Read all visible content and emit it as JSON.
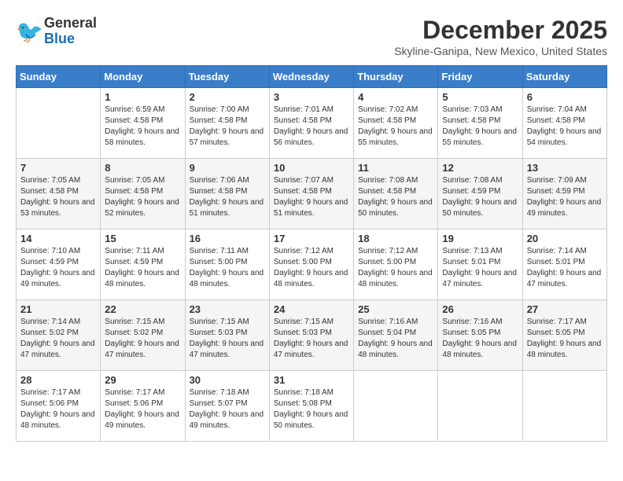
{
  "header": {
    "logo_general": "General",
    "logo_blue": "Blue",
    "month_title": "December 2025",
    "location": "Skyline-Ganipa, New Mexico, United States"
  },
  "days_of_week": [
    "Sunday",
    "Monday",
    "Tuesday",
    "Wednesday",
    "Thursday",
    "Friday",
    "Saturday"
  ],
  "weeks": [
    [
      {
        "day": "",
        "sunrise": "",
        "sunset": "",
        "daylight": ""
      },
      {
        "day": "1",
        "sunrise": "Sunrise: 6:59 AM",
        "sunset": "Sunset: 4:58 PM",
        "daylight": "Daylight: 9 hours and 58 minutes."
      },
      {
        "day": "2",
        "sunrise": "Sunrise: 7:00 AM",
        "sunset": "Sunset: 4:58 PM",
        "daylight": "Daylight: 9 hours and 57 minutes."
      },
      {
        "day": "3",
        "sunrise": "Sunrise: 7:01 AM",
        "sunset": "Sunset: 4:58 PM",
        "daylight": "Daylight: 9 hours and 56 minutes."
      },
      {
        "day": "4",
        "sunrise": "Sunrise: 7:02 AM",
        "sunset": "Sunset: 4:58 PM",
        "daylight": "Daylight: 9 hours and 55 minutes."
      },
      {
        "day": "5",
        "sunrise": "Sunrise: 7:03 AM",
        "sunset": "Sunset: 4:58 PM",
        "daylight": "Daylight: 9 hours and 55 minutes."
      },
      {
        "day": "6",
        "sunrise": "Sunrise: 7:04 AM",
        "sunset": "Sunset: 4:58 PM",
        "daylight": "Daylight: 9 hours and 54 minutes."
      }
    ],
    [
      {
        "day": "7",
        "sunrise": "Sunrise: 7:05 AM",
        "sunset": "Sunset: 4:58 PM",
        "daylight": "Daylight: 9 hours and 53 minutes."
      },
      {
        "day": "8",
        "sunrise": "Sunrise: 7:05 AM",
        "sunset": "Sunset: 4:58 PM",
        "daylight": "Daylight: 9 hours and 52 minutes."
      },
      {
        "day": "9",
        "sunrise": "Sunrise: 7:06 AM",
        "sunset": "Sunset: 4:58 PM",
        "daylight": "Daylight: 9 hours and 51 minutes."
      },
      {
        "day": "10",
        "sunrise": "Sunrise: 7:07 AM",
        "sunset": "Sunset: 4:58 PM",
        "daylight": "Daylight: 9 hours and 51 minutes."
      },
      {
        "day": "11",
        "sunrise": "Sunrise: 7:08 AM",
        "sunset": "Sunset: 4:58 PM",
        "daylight": "Daylight: 9 hours and 50 minutes."
      },
      {
        "day": "12",
        "sunrise": "Sunrise: 7:08 AM",
        "sunset": "Sunset: 4:59 PM",
        "daylight": "Daylight: 9 hours and 50 minutes."
      },
      {
        "day": "13",
        "sunrise": "Sunrise: 7:09 AM",
        "sunset": "Sunset: 4:59 PM",
        "daylight": "Daylight: 9 hours and 49 minutes."
      }
    ],
    [
      {
        "day": "14",
        "sunrise": "Sunrise: 7:10 AM",
        "sunset": "Sunset: 4:59 PM",
        "daylight": "Daylight: 9 hours and 49 minutes."
      },
      {
        "day": "15",
        "sunrise": "Sunrise: 7:11 AM",
        "sunset": "Sunset: 4:59 PM",
        "daylight": "Daylight: 9 hours and 48 minutes."
      },
      {
        "day": "16",
        "sunrise": "Sunrise: 7:11 AM",
        "sunset": "Sunset: 5:00 PM",
        "daylight": "Daylight: 9 hours and 48 minutes."
      },
      {
        "day": "17",
        "sunrise": "Sunrise: 7:12 AM",
        "sunset": "Sunset: 5:00 PM",
        "daylight": "Daylight: 9 hours and 48 minutes."
      },
      {
        "day": "18",
        "sunrise": "Sunrise: 7:12 AM",
        "sunset": "Sunset: 5:00 PM",
        "daylight": "Daylight: 9 hours and 48 minutes."
      },
      {
        "day": "19",
        "sunrise": "Sunrise: 7:13 AM",
        "sunset": "Sunset: 5:01 PM",
        "daylight": "Daylight: 9 hours and 47 minutes."
      },
      {
        "day": "20",
        "sunrise": "Sunrise: 7:14 AM",
        "sunset": "Sunset: 5:01 PM",
        "daylight": "Daylight: 9 hours and 47 minutes."
      }
    ],
    [
      {
        "day": "21",
        "sunrise": "Sunrise: 7:14 AM",
        "sunset": "Sunset: 5:02 PM",
        "daylight": "Daylight: 9 hours and 47 minutes."
      },
      {
        "day": "22",
        "sunrise": "Sunrise: 7:15 AM",
        "sunset": "Sunset: 5:02 PM",
        "daylight": "Daylight: 9 hours and 47 minutes."
      },
      {
        "day": "23",
        "sunrise": "Sunrise: 7:15 AM",
        "sunset": "Sunset: 5:03 PM",
        "daylight": "Daylight: 9 hours and 47 minutes."
      },
      {
        "day": "24",
        "sunrise": "Sunrise: 7:15 AM",
        "sunset": "Sunset: 5:03 PM",
        "daylight": "Daylight: 9 hours and 47 minutes."
      },
      {
        "day": "25",
        "sunrise": "Sunrise: 7:16 AM",
        "sunset": "Sunset: 5:04 PM",
        "daylight": "Daylight: 9 hours and 48 minutes."
      },
      {
        "day": "26",
        "sunrise": "Sunrise: 7:16 AM",
        "sunset": "Sunset: 5:05 PM",
        "daylight": "Daylight: 9 hours and 48 minutes."
      },
      {
        "day": "27",
        "sunrise": "Sunrise: 7:17 AM",
        "sunset": "Sunset: 5:05 PM",
        "daylight": "Daylight: 9 hours and 48 minutes."
      }
    ],
    [
      {
        "day": "28",
        "sunrise": "Sunrise: 7:17 AM",
        "sunset": "Sunset: 5:06 PM",
        "daylight": "Daylight: 9 hours and 48 minutes."
      },
      {
        "day": "29",
        "sunrise": "Sunrise: 7:17 AM",
        "sunset": "Sunset: 5:06 PM",
        "daylight": "Daylight: 9 hours and 49 minutes."
      },
      {
        "day": "30",
        "sunrise": "Sunrise: 7:18 AM",
        "sunset": "Sunset: 5:07 PM",
        "daylight": "Daylight: 9 hours and 49 minutes."
      },
      {
        "day": "31",
        "sunrise": "Sunrise: 7:18 AM",
        "sunset": "Sunset: 5:08 PM",
        "daylight": "Daylight: 9 hours and 50 minutes."
      },
      {
        "day": "",
        "sunrise": "",
        "sunset": "",
        "daylight": ""
      },
      {
        "day": "",
        "sunrise": "",
        "sunset": "",
        "daylight": ""
      },
      {
        "day": "",
        "sunrise": "",
        "sunset": "",
        "daylight": ""
      }
    ]
  ]
}
